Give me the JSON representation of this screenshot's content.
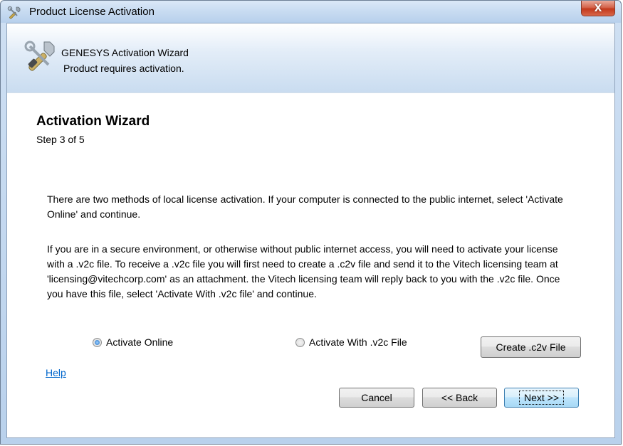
{
  "window": {
    "title": "Product License Activation",
    "close_label": "X"
  },
  "banner": {
    "title": "GENESYS Activation Wizard",
    "subtitle": "Product requires activation."
  },
  "wizard": {
    "heading": "Activation Wizard",
    "step": "Step 3 of 5",
    "paragraph1": "There are two methods of local license activation.  If your computer is connected to the public internet, select 'Activate Online' and continue.",
    "paragraph2": "If you are in a secure environment, or otherwise without public internet access, you will need to activate your license with a .v2c file.  To receive a .v2c file you will first need to create a .c2v file and send it to the Vitech licensing team at 'licensing@vitechcorp.com' as an attachment. the Vitech licensing team will reply back to you with the .v2c file.  Once you have this file, select 'Activate With .v2c file' and continue."
  },
  "options": {
    "online_label": "Activate Online",
    "v2c_label": "Activate With .v2c File",
    "selected": "Activate Online"
  },
  "buttons": {
    "create_c2v": "Create .c2v File",
    "help": "Help",
    "cancel": "Cancel",
    "back": "<< Back",
    "next": "Next >>"
  },
  "colors": {
    "link": "#0066cc",
    "close_button": "#c3391c",
    "banner_gradient_end": "#c9dcf0"
  },
  "icons": {
    "title_icon": "tools-icon",
    "banner_icon": "tools-icon"
  }
}
